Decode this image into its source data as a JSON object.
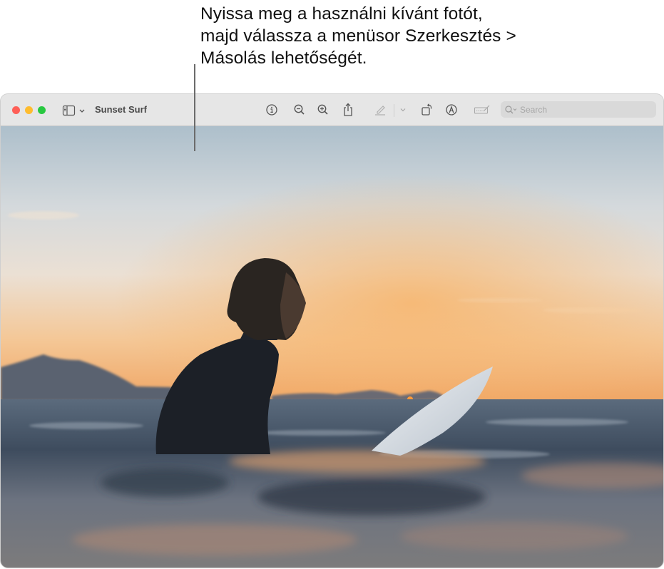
{
  "callout": {
    "lines": [
      "Nyissa meg a használni kívánt fotót,",
      "majd válassza a menüsor Szerkesztés >",
      "Másolás lehetőségét."
    ]
  },
  "window": {
    "title": "Sunset Surf",
    "traffic_lights": {
      "close": "#fe5f57",
      "minimize": "#febc2e",
      "maximize": "#28c840"
    },
    "toolbar": [
      {
        "icon": "info-icon",
        "label": "Info"
      },
      {
        "icon": "zoom-out-icon",
        "label": "Zoom Out"
      },
      {
        "icon": "zoom-in-icon",
        "label": "Zoom In"
      },
      {
        "icon": "share-icon",
        "label": "Share"
      },
      {
        "icon": "highlight-pen-icon",
        "label": "Highlight"
      },
      {
        "icon": "chevron-down-icon",
        "label": "Highlight options"
      },
      {
        "icon": "rotate-icon",
        "label": "Rotate"
      },
      {
        "icon": "markup-icon",
        "label": "Markup"
      },
      {
        "icon": "signature-icon",
        "label": "Sign"
      }
    ],
    "search": {
      "placeholder": "Search",
      "value": ""
    }
  },
  "photo": {
    "subject": "Surfer in wetsuit sitting in the sea at sunset with surfboard",
    "colors": {
      "sky_top": "#b3c3cd",
      "sky_mid": "#e2e0dc",
      "horizon_glow": "#f1b06c",
      "sea_dark": "#3b4a5c",
      "wetsuit": "#1d2128",
      "board": "#dfe3e8"
    }
  }
}
